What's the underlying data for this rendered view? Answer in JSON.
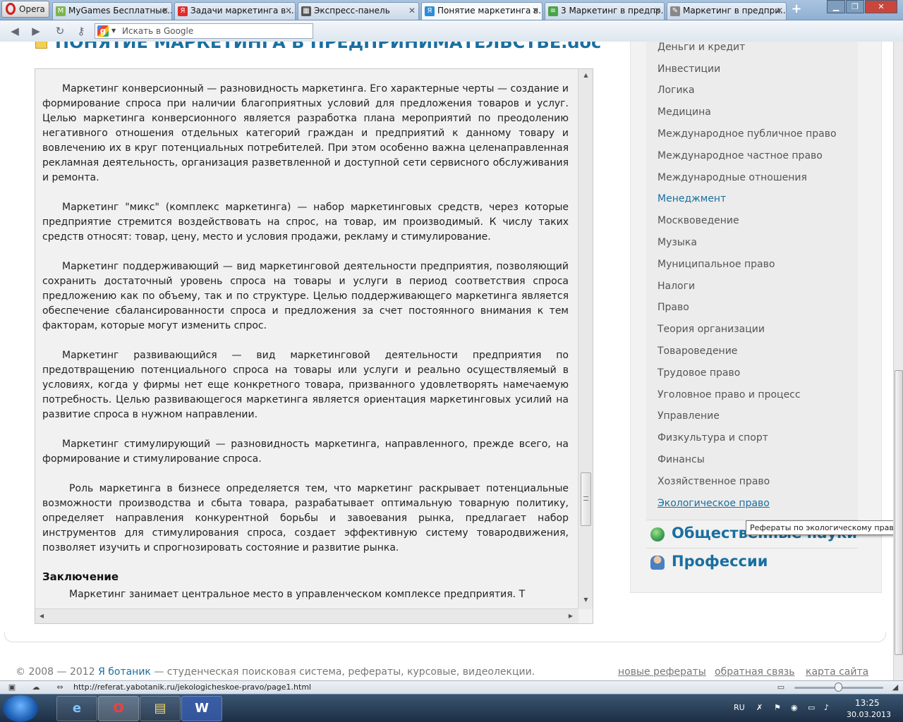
{
  "browser": {
    "menu_label": "Opera",
    "tabs": [
      {
        "label": "MyGames Бесплатные...",
        "icon_color": "#7ab648"
      },
      {
        "label": "Задачи маркетинга в ...",
        "icon_color": "#e12b2b"
      },
      {
        "label": "Экспресс-панель",
        "icon_color": "#555555"
      },
      {
        "label": "Понятие маркетинга в...",
        "icon_color": "#2a8fd6"
      },
      {
        "label": "3 Маркетинг в предпр...",
        "icon_color": "#4aa34a"
      },
      {
        "label": "Маркетинг в предпри...",
        "icon_color": "#888888"
      }
    ],
    "search_placeholder": "Искать в Google",
    "status_url": "http://referat.yabotanik.ru/jekologicheskoe-pravo/page1.html"
  },
  "document": {
    "title": "ПОНЯТИЕ МАРКЕТИНГА В ПРЕДПРИНИМАТЕЛЬСТВЕ.doc",
    "paragraphs": [
      "Маркетинг конверсионный — разновидность маркетинга. Его характерные черты — создание и формирование спроса при наличии благоприятных условий для предложения товаров и услуг. Целью маркетинга конверсионного является разработка плана мероприятий по преодолению негативного отношения отдельных категорий граждан и предприятий к данному товару и вовлечению их в круг потенциальных потребителей. При этом особенно важна целенаправленная рекламная деятельность, организация разветвленной и доступной сети сервисного обслуживания и ремонта.",
      "Маркетинг \"микс\" (комплекс маркетинга) — набор маркетинговых средств, через которые предприятие стремится воздействовать на спрос, на товар, им производимый. К числу таких средств относят: товар, цену, место и условия продажи, рекламу и стимулирование.",
      "Маркетинг поддерживающий — вид маркетинговой деятельности предприятия, позволяющий сохранить достаточный уровень спроса на товары и услуги в период соответствия спроса предложению как по объему, так и по структуре. Целью поддерживающего маркетинга является обеспечение сбалансированности спроса и предложения за счет постоянного внимания к тем факторам, которые могут изменить спрос.",
      "Маркетинг развивающийся — вид маркетинговой деятельности предприятия по предотвращению потенциального спроса на товары или услуги и реально осуществляемый в условиях, когда у фирмы нет еще конкретного товара, призванного удовлетворять намечаемую потребность. Целью развивающегося маркетинга является ориентация маркетинговых усилий на развитие спроса в нужном направлении.",
      "Маркетинг стимулирующий — разновидность маркетинга, направленного, прежде всего, на формирование и стимулирование спроса.",
      "Роль маркетинга в бизнесе определяется тем, что маркетинг раскрывает потенциальные возможности производства и сбыта товара, разрабатывает оптимальную товарную политику, определяет направления конкурентной борьбы и завоевания рынка, предлагает набор инструментов для стимулирования спроса, создает эффективную систему товародвижения, позволяет изучить и спрогнозировать состояние и развитие рынка."
    ],
    "conclusion_heading": "Заключение",
    "conclusion_text": "Маркетинг занимает центральное место в управленческом комплексе предприятия. Т"
  },
  "sidebar": {
    "categories": [
      "Деньги и кредит",
      "Инвестиции",
      "Логика",
      "Медицина",
      "Международное публичное право",
      "Международное частное право",
      "Международные отношения",
      "Менеджмент",
      "Москвоведение",
      "Музыка",
      "Муниципальное право",
      "Налоги",
      "Право",
      "Теория организации",
      "Товароведение",
      "Трудовое право",
      "Уголовное право и процесс",
      "Управление",
      "Физкультура и спорт",
      "Финансы",
      "Хозяйственное право",
      "Экологическое право"
    ],
    "active_category": "Менеджмент",
    "hovered_category": "Экологическое право",
    "sections": [
      {
        "label": "Общественные науки",
        "icon_color": "#3fa34d"
      },
      {
        "label": "Профессии",
        "icon_color": "#4a7fc1"
      }
    ],
    "tooltip": "Рефераты по экологическому праву"
  },
  "footer": {
    "copyright": "© 2008 — 2012",
    "brand": "Я ботаник",
    "tagline": "— студенческая поисковая система, рефераты, курсовые, видеолекции.",
    "links": [
      "новые рефераты",
      "обратная связь",
      "карта сайта"
    ]
  },
  "taskbar": {
    "lang": "RU",
    "time": "13:25",
    "date": "30.03.2013"
  },
  "colors": {
    "link": "#1a6fa0",
    "text": "#222222"
  }
}
